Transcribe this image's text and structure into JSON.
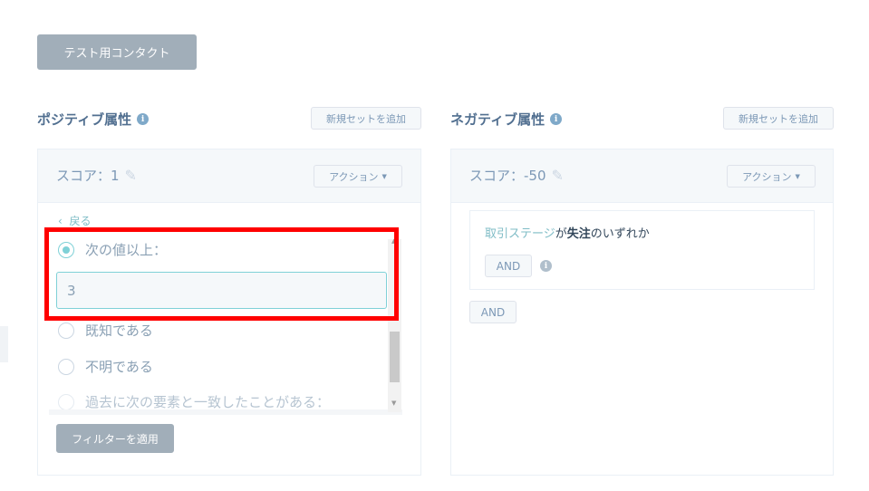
{
  "header": {
    "test_contact_label": "テスト用コンタクト"
  },
  "positive": {
    "title": "ポジティブ属性",
    "add_set_label": "新規セットを追加",
    "score_label": "スコア：1",
    "action_label": "アクション",
    "back_label": "戻る",
    "options": [
      {
        "label": "次の値以上：",
        "checked": true
      },
      {
        "label": "既知である",
        "checked": false
      },
      {
        "label": "不明である",
        "checked": false
      },
      {
        "label": "過去に次の要素と一致したことがある：",
        "checked": false
      }
    ],
    "value_input": "3",
    "apply_label": "フィルターを適用"
  },
  "negative": {
    "title": "ネガティブ属性",
    "add_set_label": "新規セットを追加",
    "score_label": "スコア：-50",
    "action_label": "アクション",
    "condition": {
      "property": "取引ステージ",
      "particle1": "が",
      "value": "失注",
      "particle2": "のいずれか"
    },
    "inner_and_label": "AND",
    "outer_and_label": "AND"
  },
  "icons": {
    "info": "info-icon",
    "pencil": "pencil-icon",
    "caret": "caret-down-icon",
    "back": "chevron-left-icon"
  },
  "colors": {
    "accent_teal": "#7fd1d7",
    "link": "#7fbcc6",
    "highlight": "#ff0000",
    "button_dark": "#a1aeb9"
  }
}
